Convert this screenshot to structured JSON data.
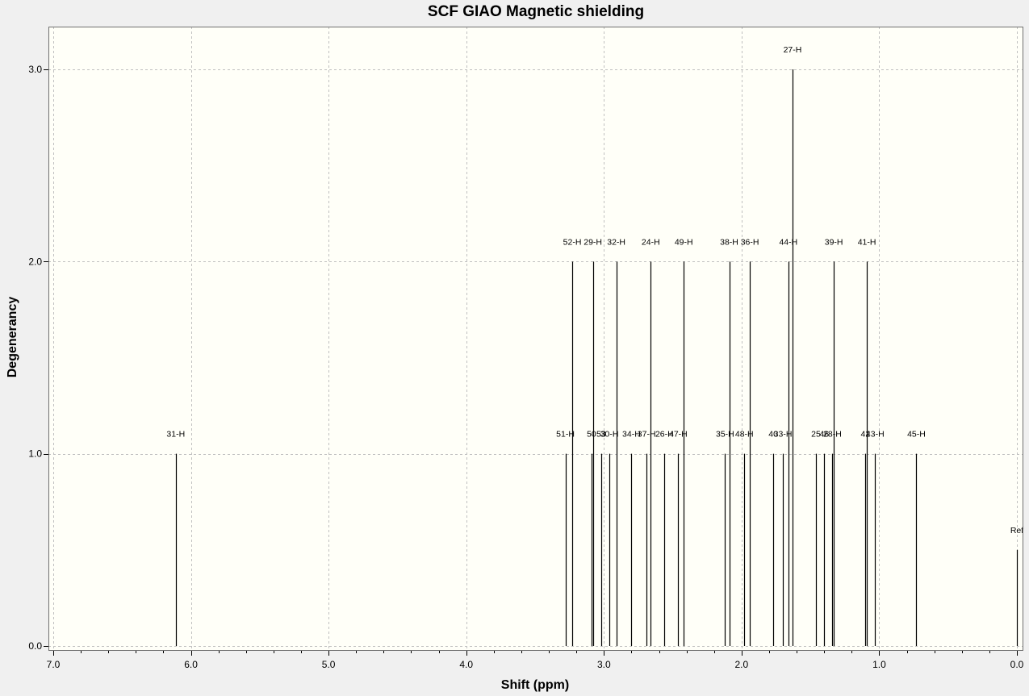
{
  "chart_data": {
    "type": "bar",
    "title": "SCF GIAO Magnetic shielding",
    "xlabel": "Shift (ppm)",
    "ylabel": "Degenerancy",
    "xlim": [
      7.0,
      0.0
    ],
    "ylim": [
      0.0,
      3.2
    ],
    "x_reversed": true,
    "grid": true,
    "x_ticks": [
      "7.0",
      "6.0",
      "5.0",
      "4.0",
      "3.0",
      "2.0",
      "1.0",
      "0.0"
    ],
    "y_ticks": [
      "0.0",
      "1.0",
      "2.0",
      "3.0"
    ],
    "colors": {
      "plot_bg": "#fffff8",
      "page_bg": "#f0f0f0",
      "line": "#000000",
      "grid": "#c0c0c0"
    },
    "peaks": [
      {
        "label": "31-H",
        "x": 6.11,
        "y": 1
      },
      {
        "label": "51-H",
        "x": 3.28,
        "y": 1
      },
      {
        "label": "52-H",
        "x": 3.23,
        "y": 2
      },
      {
        "label": "50",
        "x": 3.09,
        "y": 1
      },
      {
        "label": "29-H",
        "x": 3.08,
        "y": 2
      },
      {
        "label": "53",
        "x": 3.02,
        "y": 1
      },
      {
        "label": "30-H",
        "x": 2.96,
        "y": 1
      },
      {
        "label": "32-H",
        "x": 2.91,
        "y": 2
      },
      {
        "label": "34-H",
        "x": 2.8,
        "y": 1
      },
      {
        "label": "37-H",
        "x": 2.69,
        "y": 1
      },
      {
        "label": "24-H",
        "x": 2.66,
        "y": 2
      },
      {
        "label": "26-H",
        "x": 2.56,
        "y": 1
      },
      {
        "label": "47-H",
        "x": 2.46,
        "y": 1
      },
      {
        "label": "49-H",
        "x": 2.42,
        "y": 2
      },
      {
        "label": "35-H",
        "x": 2.12,
        "y": 1
      },
      {
        "label": "38-H",
        "x": 2.09,
        "y": 2
      },
      {
        "label": "48-H",
        "x": 1.98,
        "y": 1
      },
      {
        "label": "36-H",
        "x": 1.94,
        "y": 2
      },
      {
        "label": "40",
        "x": 1.77,
        "y": 1
      },
      {
        "label": "33-H",
        "x": 1.7,
        "y": 1
      },
      {
        "label": "44-H",
        "x": 1.66,
        "y": 2
      },
      {
        "label": "27-H",
        "x": 1.63,
        "y": 3
      },
      {
        "label": "25",
        "x": 1.46,
        "y": 1
      },
      {
        "label": "46",
        "x": 1.4,
        "y": 1
      },
      {
        "label": "28-H",
        "x": 1.34,
        "y": 1
      },
      {
        "label": "39-H",
        "x": 1.33,
        "y": 2
      },
      {
        "label": "42",
        "x": 1.1,
        "y": 1
      },
      {
        "label": "41-H",
        "x": 1.09,
        "y": 2
      },
      {
        "label": "43-H",
        "x": 1.03,
        "y": 1
      },
      {
        "label": "45-H",
        "x": 0.73,
        "y": 1
      },
      {
        "label": "Ref",
        "x": 0.0,
        "y": 0.5
      }
    ]
  }
}
